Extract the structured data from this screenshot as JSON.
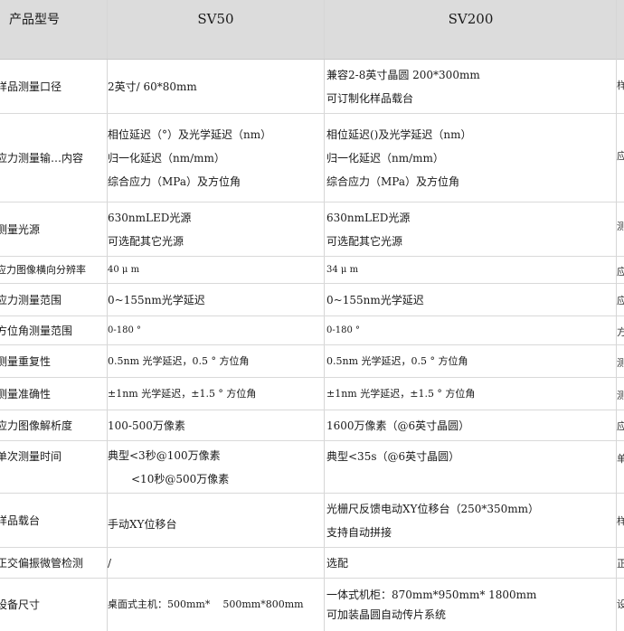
{
  "header": {
    "label": "产品型号",
    "models": [
      "SV50",
      "SV200"
    ]
  },
  "rows": [
    {
      "label": "样品测量口径",
      "sv50": [
        "2英寸/ 60*80mm"
      ],
      "sv200": [
        "兼容2-8英寸晶圆 200*300mm",
        "可订制化样品载台"
      ]
    },
    {
      "label": "应力测量输…内容",
      "sv50": [
        "相位延迟（°）及光学延迟（nm）",
        "归一化延迟（nm/mm）",
        "综合应力（MPa）及方位角"
      ],
      "sv200": [
        "相位延迟()及光学延迟（nm）",
        "归一化延迟（nm/mm）",
        "综合应力（MPa）及方位角"
      ]
    },
    {
      "label": "测量光源",
      "sv50": [
        "630nmLED光源",
        "可选配其它光源"
      ],
      "sv200": [
        "630nmLED光源",
        "可选配其它光源"
      ]
    },
    {
      "label": "应力图像横向分辨率",
      "sv50": [
        "40 μ m"
      ],
      "sv200": [
        "34 μ m"
      ]
    },
    {
      "label": "应力测量范围",
      "sv50": [
        "0~155nm光学延迟"
      ],
      "sv200": [
        "0~155nm光学延迟"
      ]
    },
    {
      "label": "方位角测量范围",
      "sv50": [
        "0-180 °"
      ],
      "sv200": [
        "0-180 °"
      ]
    },
    {
      "label": "测量重复性",
      "sv50": [
        "0.5nm 光学延迟，0.5 ° 方位角"
      ],
      "sv200": [
        "0.5nm 光学延迟，0.5 ° 方位角"
      ]
    },
    {
      "label": "测量准确性",
      "sv50": [
        "±1nm 光学延迟，±1.5 ° 方位角"
      ],
      "sv200": [
        "±1nm 光学延迟，±1.5 ° 方位角"
      ]
    },
    {
      "label": "应力图像解析度",
      "sv50": [
        "100-500万像素"
      ],
      "sv200": [
        "1600万像素（@6英寸晶圆）"
      ]
    },
    {
      "label": "单次测量时间",
      "sv50": [
        "典型<3秒@100万像素",
        "<10秒@500万像素"
      ],
      "sv200": [
        "典型<35s（@6英寸晶圆）"
      ]
    },
    {
      "label": "样品载台",
      "sv50": [
        "手动XY位移台"
      ],
      "sv200": [
        "光栅尺反馈电动XY位移台（250*350mm）",
        "支持自动拼接"
      ]
    },
    {
      "label": "正交偏振微管检测",
      "sv50": [
        "/"
      ],
      "sv200": [
        "选配"
      ]
    },
    {
      "label": "设备尺寸",
      "sv50": [
        "桌面式主机：500mm*    500mm*800mm"
      ],
      "sv200": [
        "一体式机柜：870mm*950mm* 1800mm",
        "可加装晶圆自动传片系统"
      ]
    }
  ],
  "clipped_right": [
    "样",
    "应",
    "测",
    "应",
    "应",
    "方",
    "测",
    "测",
    "应",
    "单",
    "样",
    "正",
    "设"
  ]
}
